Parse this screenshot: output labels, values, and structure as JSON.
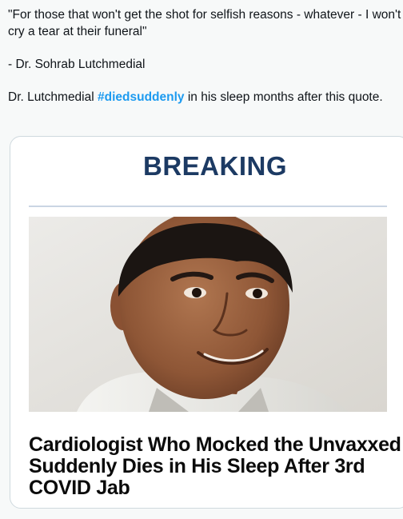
{
  "tweet": {
    "quote_line": "\"For those that won't get the shot for selfish reasons - whatever - I won't cry a tear at their funeral\"",
    "attribution": "- Dr. Sohrab Lutchmedial",
    "comment_before": "Dr. Lutchmedial ",
    "hashtag": "#diedsuddenly",
    "comment_after": " in his sleep months after this quote."
  },
  "card": {
    "banner": "BREAKING",
    "photo_subject": "portrait photo of a smiling man",
    "headline": "Cardiologist Who Mocked the Unvaxxed Suddenly Dies in His Sleep After 3rd COVID Jab"
  },
  "colors": {
    "banner": "#1c3a63",
    "hashtag": "#1d9bf0",
    "page_bg": "#f7f9f9"
  }
}
